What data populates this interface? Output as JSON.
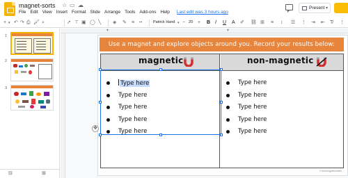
{
  "app": {
    "doc_title": "magnet-sorts",
    "menu": [
      "File",
      "Edit",
      "View",
      "Insert",
      "Format",
      "Slide",
      "Arrange",
      "Tools",
      "Add-ons",
      "Help"
    ],
    "last_edit": "Last edit was 3 hours ago",
    "present_label": "Present",
    "brand_color": "#f4b400",
    "icons": [
      "slides-logo",
      "star-icon",
      "move-folder-icon",
      "cloud-icon",
      "comment-icon",
      "present-icon",
      "share-icon"
    ]
  },
  "toolbar": {
    "font": "Patrick Hand",
    "font_size": "20",
    "icons": [
      "new-slide-icon",
      "undo-icon",
      "redo-icon",
      "print-icon",
      "paint-format-icon",
      "zoom-icon",
      "select-icon",
      "textbox-icon",
      "image-icon",
      "shape-icon",
      "line-icon",
      "fill-color-icon",
      "border-color-icon",
      "bold-icon",
      "italic-icon",
      "underline-icon",
      "text-color-icon",
      "highlight-icon",
      "link-icon",
      "comment-icon",
      "align-icon",
      "line-spacing-icon",
      "bullets-icon",
      "numbered-list-icon",
      "indent-icon",
      "more-icon"
    ]
  },
  "filmstrip": {
    "slides": [
      {
        "number": "1",
        "selected": true
      },
      {
        "number": "2",
        "selected": false
      },
      {
        "number": "3",
        "selected": false
      }
    ]
  },
  "slide": {
    "banner": "Use a magnet and explore objects around you. Record your results below:",
    "banner_color": "#e8853d",
    "col_left": "magnetic",
    "col_right": "non-magnetic",
    "left_items": [
      "Type here",
      "Type here",
      "Type here",
      "Type here",
      "Type here"
    ],
    "right_items": [
      "Type here",
      "Type here",
      "Type here",
      "Type here",
      "Type here"
    ],
    "credit": "© learningwithsmiles"
  }
}
